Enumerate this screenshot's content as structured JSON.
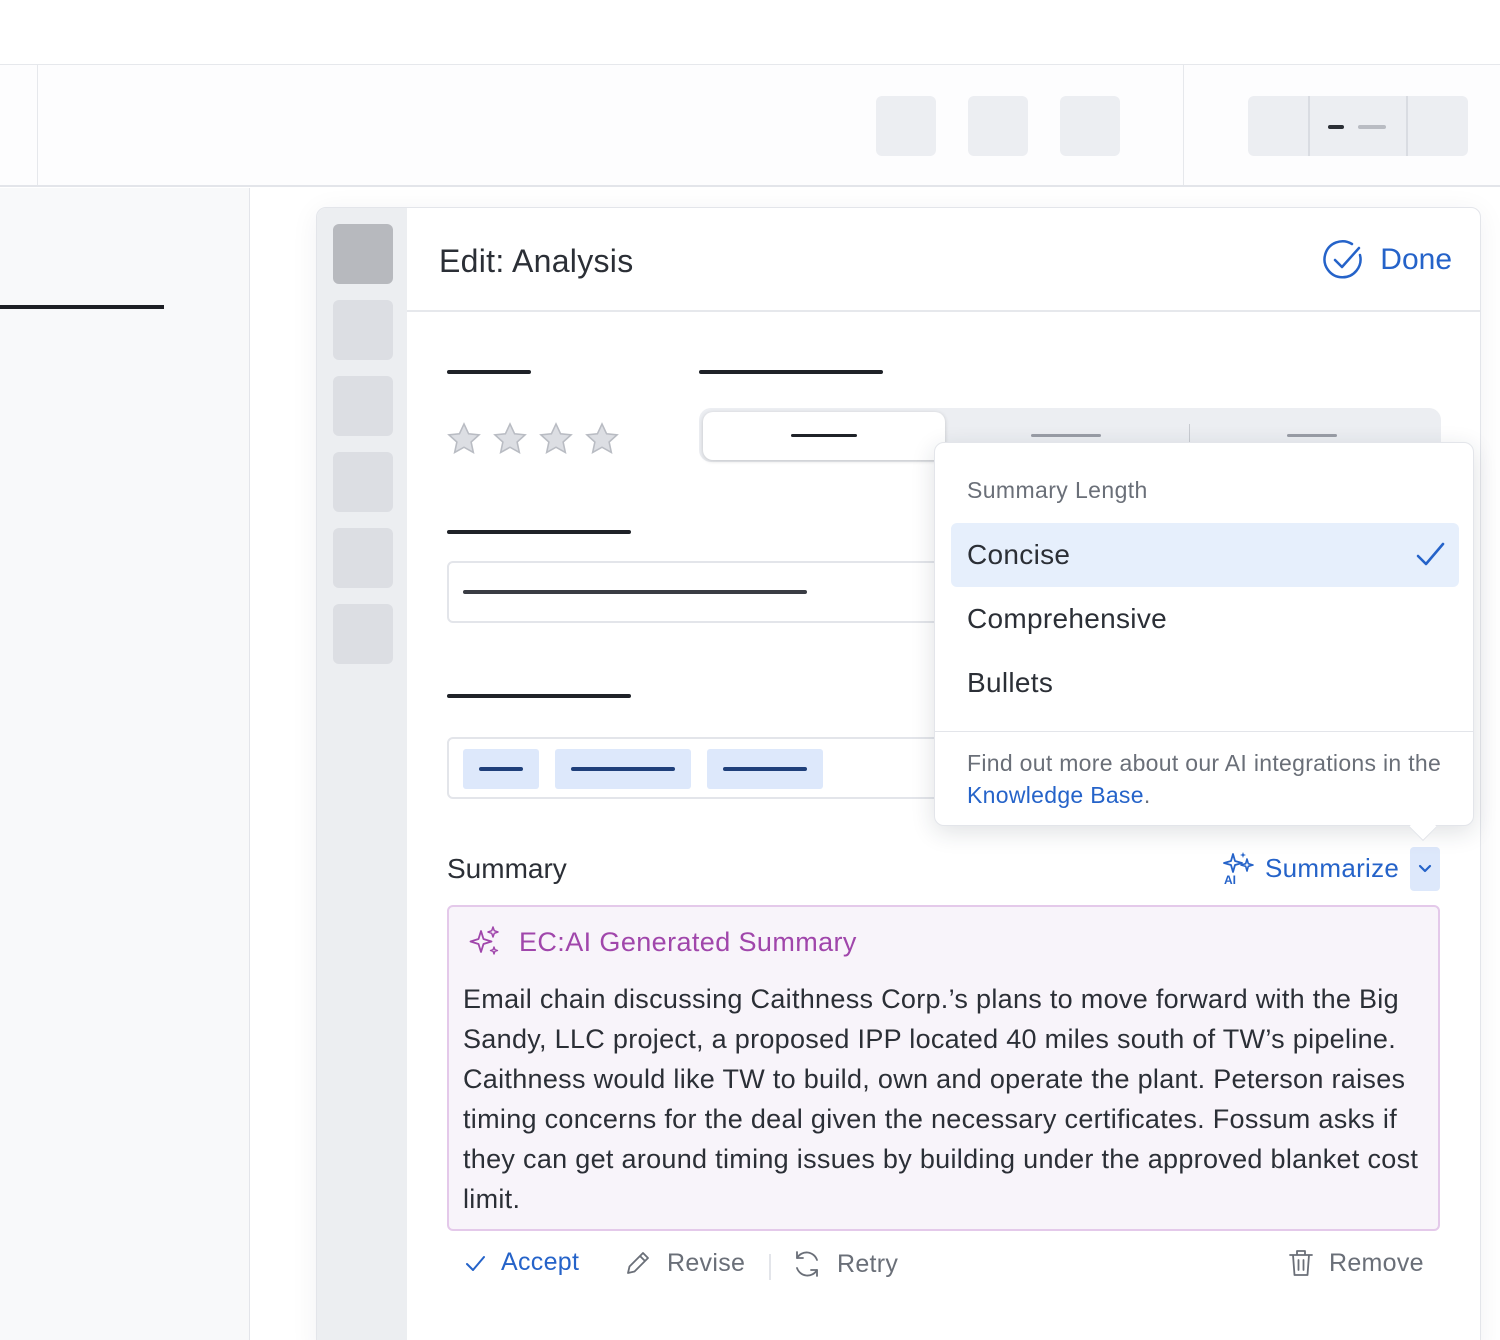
{
  "panel": {
    "title": "Edit: Analysis",
    "done_label": "Done"
  },
  "summary": {
    "label": "Summary",
    "summarize_label": "Summarize",
    "ai_badge": "AI",
    "ai_title": "EC:AI Generated Summary",
    "ai_text": "Email chain discussing Caithness Corp.’s plans to move forward with the Big Sandy, LLC project, a proposed IPP located 40 miles south of TW’s pipeline. Caithness would like TW to build, own and operate the plant. Peterson raises timing concerns for the deal given the necessary certificates. Fossum asks if they can get around timing issues by building under the approved blanket cost limit.",
    "actions": {
      "accept": "Accept",
      "revise": "Revise",
      "retry": "Retry",
      "remove": "Remove"
    }
  },
  "rating": {
    "stars_filled": 0,
    "stars_total": 4
  },
  "dropdown": {
    "header": "Summary Length",
    "options": [
      {
        "label": "Concise",
        "selected": true
      },
      {
        "label": "Comprehensive",
        "selected": false
      },
      {
        "label": "Bullets",
        "selected": false
      }
    ],
    "footer_text": "Find out more about our AI integrations in the ",
    "footer_link": "Knowledge Base",
    "footer_end": "."
  },
  "colors": {
    "accent": "#2563c9",
    "ai_purple": "#a046ab",
    "ai_bg": "#f8f4fa",
    "selected_bg": "#e6effc"
  }
}
